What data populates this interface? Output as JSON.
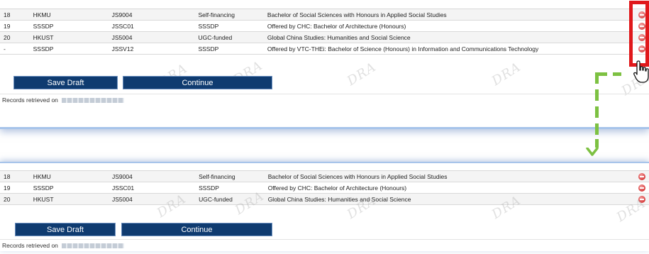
{
  "top_panel": {
    "rows": [
      {
        "no": "18",
        "institution": "HKMU",
        "code": "JS9004",
        "funding": "Self-financing",
        "programme": "Bachelor of Social Sciences with Honours in Applied Social Studies"
      },
      {
        "no": "19",
        "institution": "SSSDP",
        "code": "JSSC01",
        "funding": "SSSDP",
        "programme": "Offered by CHC: Bachelor of Architecture (Honours)"
      },
      {
        "no": "20",
        "institution": "HKUST",
        "code": "JS5004",
        "funding": "UGC-funded",
        "programme": "Global China Studies: Humanities and Social Science"
      },
      {
        "no": "-",
        "institution": "SSSDP",
        "code": "JSSV12",
        "funding": "SSSDP",
        "programme": "Offered by VTC-THEi: Bachelor of Science (Honours) in Information and Communications Technology"
      }
    ],
    "save_draft_label": "Save Draft",
    "continue_label": "Continue",
    "retrieved_label": "Records retrieved on"
  },
  "bottom_panel": {
    "rows": [
      {
        "no": "18",
        "institution": "HKMU",
        "code": "JS9004",
        "funding": "Self-financing",
        "programme": "Bachelor of Social Sciences with Honours in Applied Social Studies"
      },
      {
        "no": "19",
        "institution": "SSSDP",
        "code": "JSSC01",
        "funding": "SSSDP",
        "programme": "Offered by CHC: Bachelor of Architecture (Honours)"
      },
      {
        "no": "20",
        "institution": "HKUST",
        "code": "JS5004",
        "funding": "UGC-funded",
        "programme": "Global China Studies: Humanities and Social Science"
      }
    ],
    "save_draft_label": "Save Draft",
    "continue_label": "Continue",
    "retrieved_label": "Records retrieved on"
  },
  "watermark_text": "DRA",
  "icons": {
    "row_action": "remove-icon",
    "pointer": "hand-cursor-icon",
    "flow": "dashed-arrow-down-icon"
  },
  "colors": {
    "button_bg": "#0f3b70",
    "highlight": "#e0181b",
    "arrow": "#7dc142",
    "remove_icon": "#d63b3b"
  }
}
